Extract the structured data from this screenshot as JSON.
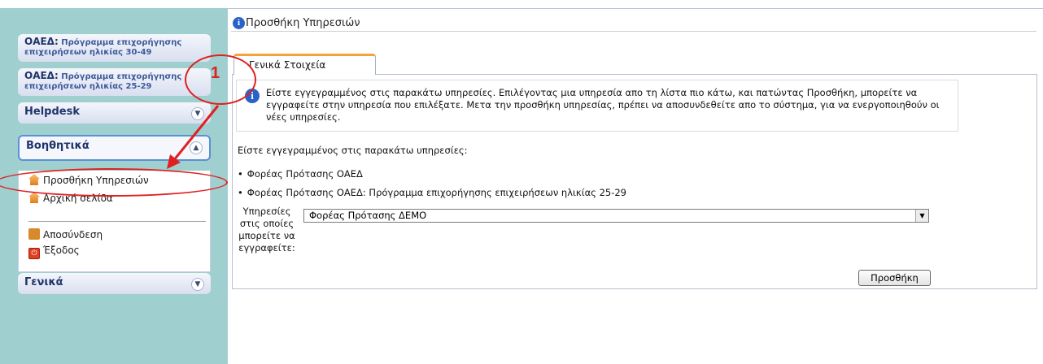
{
  "main": {
    "title": "Προσθήκη Υπηρεσιών",
    "tab": "Γενικά Στοιχεία",
    "notice": "Είστε εγγεγραμμένος στις παρακάτω υπηρεσίες. Επιλέγοντας μια υπηρεσία απο τη λίστα πιο κάτω, και πατώντας Προσθήκη, μπορείτε να εγγραφείτε στην υπηρεσία που επιλέξατε. Μετα την προσθήκη υπηρεσίας, πρέπει να αποσυνδεθείτε απο το σύστημα, για να ενεργοποιηθούν οι νέες υπηρεσίες.",
    "registered_heading": "Είστε εγγεγραμμένος στις παρακάτω υπηρεσίες:",
    "registered_items": [
      "Φορέας Πρότασης ΟΑΕΔ",
      "Φορέας Πρότασης ΟΑΕΔ: Πρόγραμμα επιχορήγησης επιχειρήσεων ηλικίας 25-29"
    ],
    "services_label": "Υπηρεσίες στις οποίες μπορείτε να εγγραφείτε:",
    "services_selected": "Φορέας Πρότασης ΔΕΜΟ",
    "add_button": "Προσθήκη"
  },
  "sidebar": {
    "programs": [
      {
        "org": "ΟΑΕΔ:",
        "line1": "Πρόγραμμα επιχορήγησης",
        "line2": "επιχειρήσεων ηλικίας 30-49"
      },
      {
        "org": "ΟΑΕΔ:",
        "line1": "Πρόγραμμα επιχορήγησης",
        "line2": "επιχειρήσεων ηλικίας 25-29"
      }
    ],
    "helpdesk": "Helpdesk",
    "auxiliary": "Βοηθητικά",
    "general": "Γενικά",
    "menu": [
      "Προσθήκη Υπηρεσιών",
      "Αρχική σελίδα",
      "Αποσύνδεση",
      "Έξοδος"
    ]
  },
  "annotation": {
    "number": "1",
    "color": "#e02020"
  },
  "icons": {
    "info": "info-icon",
    "chevron": "chevron-icon",
    "house": "house-icon",
    "logout": "logout-icon",
    "exit": "exit-icon",
    "dropdown": "dropdown-arrow-icon"
  }
}
